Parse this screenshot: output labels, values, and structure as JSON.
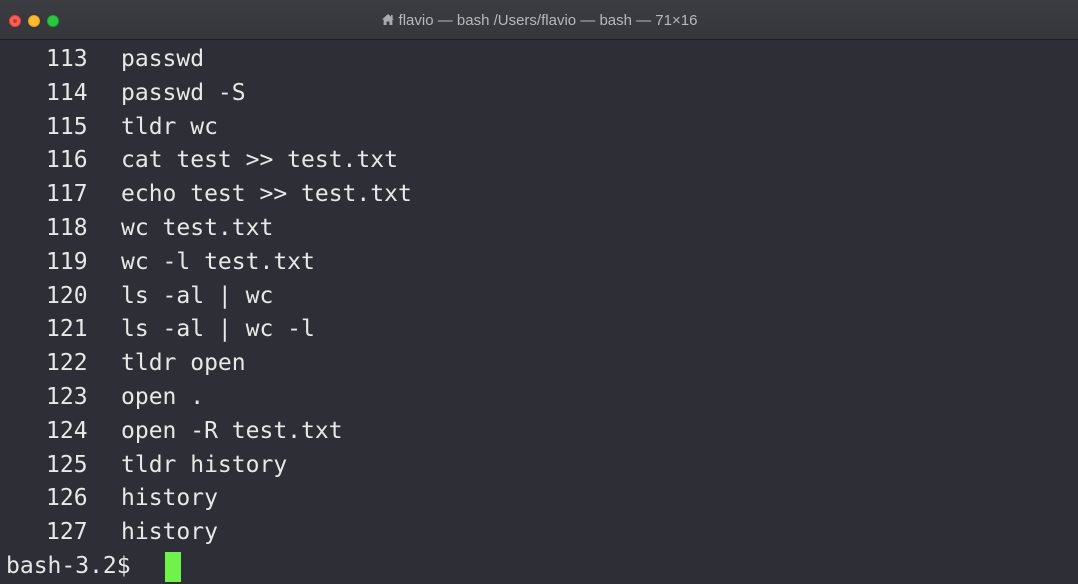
{
  "window": {
    "title": "flavio — bash /Users/flavio — bash — 71×16",
    "title_icon": "home-icon"
  },
  "history": [
    {
      "num": "113",
      "cmd": "passwd"
    },
    {
      "num": "114",
      "cmd": "passwd -S"
    },
    {
      "num": "115",
      "cmd": "tldr wc"
    },
    {
      "num": "116",
      "cmd": "cat test >> test.txt"
    },
    {
      "num": "117",
      "cmd": "echo test >> test.txt"
    },
    {
      "num": "118",
      "cmd": "wc test.txt"
    },
    {
      "num": "119",
      "cmd": "wc -l test.txt"
    },
    {
      "num": "120",
      "cmd": "ls -al | wc"
    },
    {
      "num": "121",
      "cmd": "ls -al | wc -l"
    },
    {
      "num": "122",
      "cmd": "tldr open"
    },
    {
      "num": "123",
      "cmd": "open ."
    },
    {
      "num": "124",
      "cmd": "open -R test.txt"
    },
    {
      "num": "125",
      "cmd": "tldr history"
    },
    {
      "num": "126",
      "cmd": "history"
    },
    {
      "num": "127",
      "cmd": "history"
    }
  ],
  "prompt": "bash-3.2$",
  "colors": {
    "background": "#2e2f36",
    "text": "#e8e8e8",
    "cursor": "#6ff34b",
    "close": "#ff5f57",
    "minimize": "#febc2e",
    "zoom": "#28c840"
  }
}
